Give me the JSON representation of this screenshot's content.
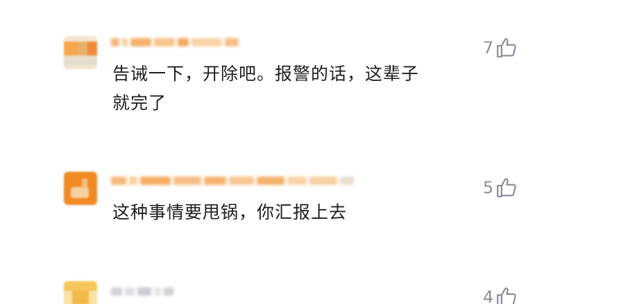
{
  "comments": [
    {
      "username": "",
      "text_lines": [
        "告诫一下，开除吧。报警的话，这辈子",
        "就完了"
      ],
      "likes": "7",
      "like_icon": "thumbs-up-icon",
      "avatar_colors": [
        "#f7a64a",
        "#e8dcc8",
        "#f3c27a"
      ]
    },
    {
      "username": "",
      "text_lines": [
        "这种事情要甩锅，你汇报上去"
      ],
      "likes": "5",
      "like_icon": "thumbs-up-icon",
      "avatar_colors": [
        "#f08a24",
        "#f6d8a6"
      ]
    },
    {
      "username": "",
      "text_lines": [],
      "likes": "4",
      "like_icon": "thumbs-up-icon",
      "avatar_colors": [
        "#f4c65c",
        "#f9e3a0"
      ]
    }
  ]
}
